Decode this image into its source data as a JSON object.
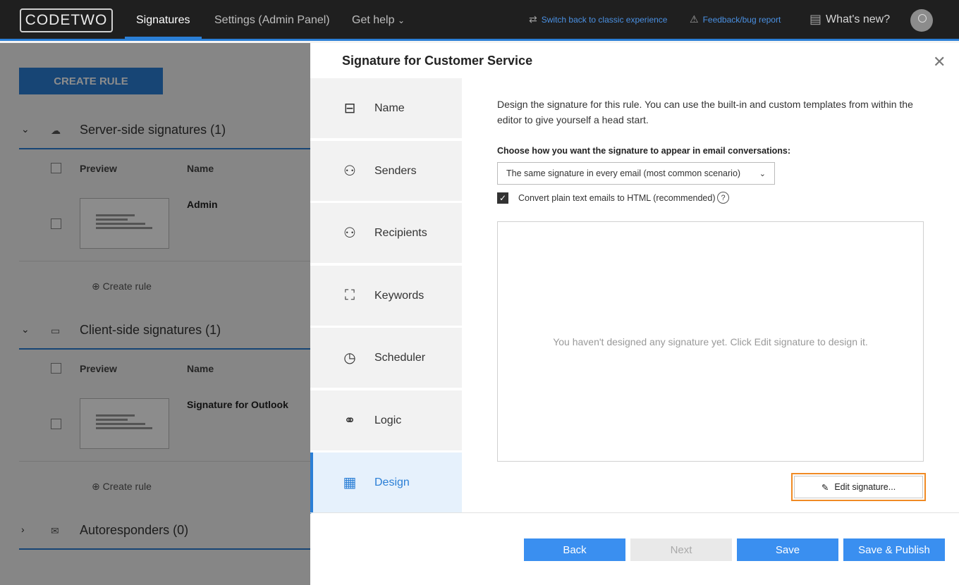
{
  "topbar": {
    "logo": "CODETWO",
    "nav": [
      "Signatures",
      "Settings (Admin Panel)",
      "Get help"
    ],
    "get_help_chevron": "⌄",
    "switch_label": "Switch back to classic experience",
    "feedback_label": "Feedback/bug report",
    "whats_new_label": "What's new?"
  },
  "background": {
    "create_rule_button": "CREATE RULE",
    "sections": [
      {
        "title": "Server-side signatures (1)",
        "icon": "cloud-icon"
      },
      {
        "title": "Client-side signatures (1)",
        "icon": "monitor-icon"
      },
      {
        "title": "Autoresponders (0)",
        "icon": "mail-icon"
      }
    ],
    "columns": {
      "preview": "Preview",
      "name": "Name"
    },
    "rows": [
      "Admin",
      "Signature for Outlook"
    ],
    "create_rule_link": "Create rule"
  },
  "modal": {
    "title": "Signature for Customer Service",
    "steps": [
      {
        "label": "Name",
        "icon": "signpost-icon"
      },
      {
        "label": "Senders",
        "icon": "senders-icon"
      },
      {
        "label": "Recipients",
        "icon": "recipients-icon"
      },
      {
        "label": "Keywords",
        "icon": "keywords-icon"
      },
      {
        "label": "Scheduler",
        "icon": "clock-icon"
      },
      {
        "label": "Logic",
        "icon": "logic-icon"
      },
      {
        "label": "Design",
        "icon": "design-icon"
      }
    ],
    "description": "Design the signature for this rule. You can use the built-in and custom templates from within the editor to give yourself a head start.",
    "choose_label": "Choose how you want the signature to appear in email conversations:",
    "select_value": "The same signature in every email (most common scenario)",
    "convert_label": "Convert plain text emails to HTML (recommended)",
    "help": "?",
    "empty_message": "You haven't designed any signature yet. Click Edit signature to design it.",
    "edit_button": "Edit signature...",
    "buttons": {
      "back": "Back",
      "next": "Next",
      "save": "Save",
      "save_publish": "Save & Publish"
    }
  }
}
